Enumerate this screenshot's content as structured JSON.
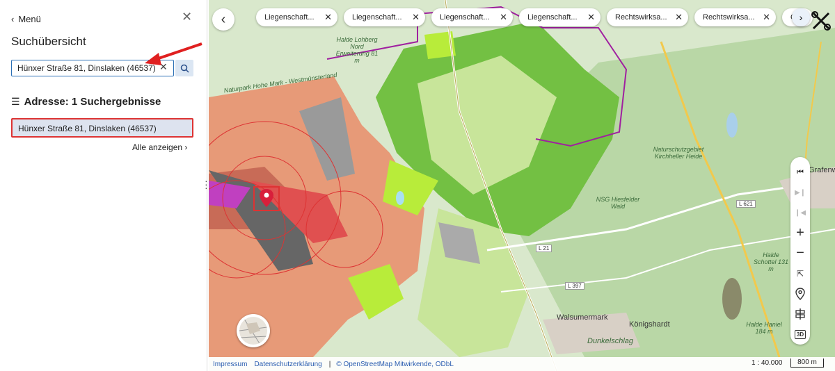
{
  "sidebar": {
    "menu_label": "Menü",
    "title": "Suchübersicht",
    "search_value": "Hünxer Straße 81, Dinslaken (46537)",
    "results_heading": "Adresse: 1 Suchergebnisse",
    "results": [
      "Hünxer Straße 81, Dinslaken (46537)"
    ],
    "show_all": "Alle anzeigen"
  },
  "chips": [
    {
      "label": "Liegenschaft..."
    },
    {
      "label": "Liegenschaft..."
    },
    {
      "label": "Liegenschaft..."
    },
    {
      "label": "Liegenschaft..."
    },
    {
      "label": "Rechtswirksa..."
    },
    {
      "label": "Rechtswirksa..."
    },
    {
      "label": "Ge"
    }
  ],
  "map": {
    "labels": {
      "halde": "Halde Lohberg Nord Erweiterung 81 m",
      "naturpark": "Naturpark Hohe Mark - Westmünsterland",
      "nsg_kirchheller": "Naturschutzgebiet Kirchheller Heide",
      "nsg_hiesfelder": "NSG Hiesfelder Wald",
      "grafenwald": "Grafenw",
      "walsumermark": "Walsumermark",
      "koenigshardt": "Königshardt",
      "dunkelschlag": "Dunkelschlag",
      "halde_haniel": "Halde Haniel 184 m",
      "halde_schottel": "Halde Schottel 131 m",
      "road_l621": "L 621",
      "road_l21": "L 21",
      "road_l397": "L 397"
    }
  },
  "footer": {
    "impressum": "Impressum",
    "datenschutz": "Datenschutzerklärung",
    "separator": "|",
    "osm": "© OpenStreetMap Mitwirkende, ODbL",
    "scale": "1 : 40.000",
    "scale_bar": "800 m"
  },
  "toolbar": {
    "icons": [
      "first-icon",
      "next-icon",
      "previous-icon",
      "zoom-in-icon",
      "zoom-out-icon",
      "fullscreen-icon",
      "location-icon",
      "signpost-icon",
      "3d-icon"
    ],
    "label_3d": "3D"
  },
  "colors": {
    "accent": "#2a6fb5",
    "highlight_border": "#dd3333",
    "result_bg": "#dde3ef",
    "search_btn_bg": "#dbe6f3"
  }
}
